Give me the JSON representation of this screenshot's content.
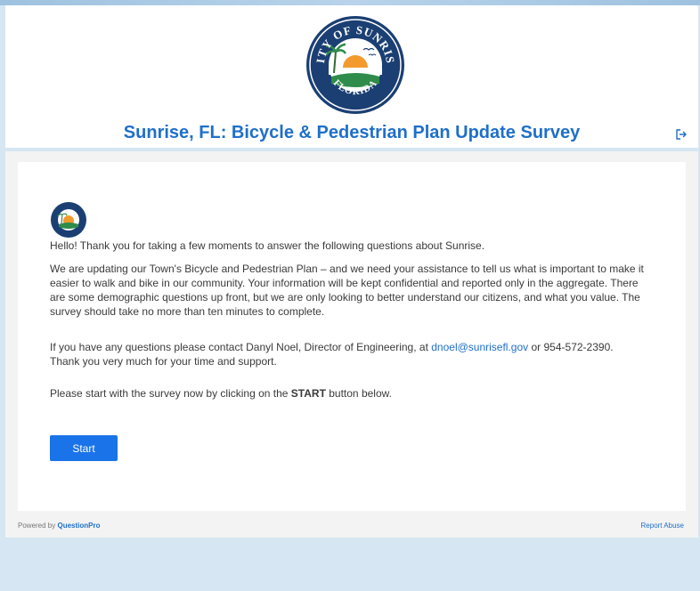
{
  "header": {
    "logo_text_top": "CITY OF SUNRISE",
    "logo_text_bottom": "FLORIDA",
    "title": "Sunrise, FL: Bicycle & Pedestrian Plan Update Survey"
  },
  "intro": {
    "greeting": "Hello! Thank you for taking a few moments to answer the following questions about Sunrise.",
    "paragraph": "We are updating our Town's Bicycle and Pedestrian Plan – and we need your assistance to tell us what is important to make it easier to walk and bike in our community. Your information will be kept confidential and reported only in the aggregate. There are some demographic questions up front, but we are only looking to better understand our citizens, and what you value. The survey should take no more than ten minutes to complete.",
    "contact_before": "If you have any questions please contact Danyl Noel, Director of Engineering, at ",
    "contact_email": "dnoel@sunrisefl.gov",
    "contact_after": " or 954-572-2390.",
    "thanks": "Thank you very much for your time and support.",
    "start_before": "Please start with the survey now by clicking on the ",
    "start_bold": "START",
    "start_after": " button below."
  },
  "buttons": {
    "start": "Start"
  },
  "footer": {
    "powered_by": "Powered by ",
    "brand": "QuestionPro",
    "report": "Report Abuse"
  },
  "colors": {
    "accent": "#1f6fc9",
    "button": "#1a73e8",
    "page_bg": "#d6e6f2"
  },
  "icons": {
    "exit": "exit-icon"
  }
}
